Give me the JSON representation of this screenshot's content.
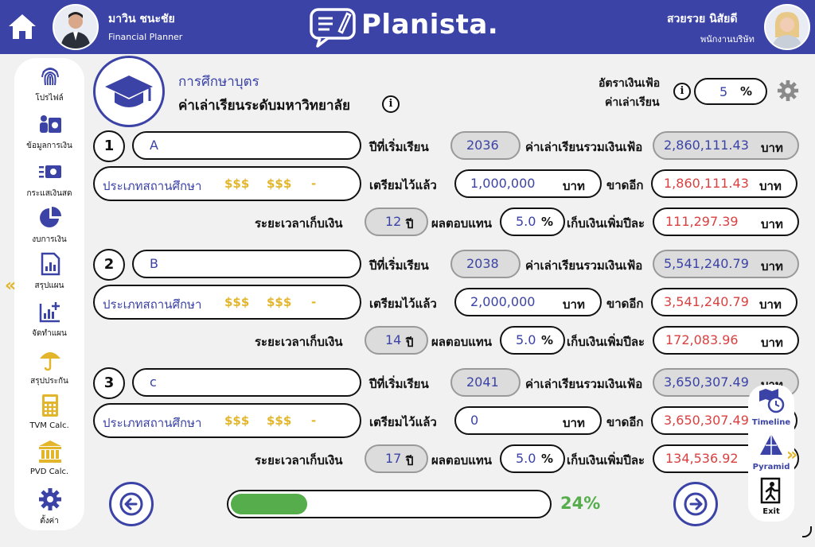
{
  "header": {
    "left_user": {
      "name": "มาวิน ชนะชัย",
      "role": "Financial Planner"
    },
    "brand": "Planista.",
    "right_user": {
      "name": "สวยรวย นิสัยดี",
      "role": "พนักงานบริษัท"
    }
  },
  "sidebar": {
    "items": [
      {
        "label": "โปรไฟล์",
        "icon": "fingerprint-icon"
      },
      {
        "label": "ข้อมูลการเงิน",
        "icon": "money-person-icon"
      },
      {
        "label": "กระแสเงินสด",
        "icon": "cashflow-icon"
      },
      {
        "label": "งบการเงิน",
        "icon": "pie-chart-icon"
      },
      {
        "label": "สรุปแผน",
        "icon": "report-icon"
      },
      {
        "label": "จัดทำแผน",
        "icon": "chart-plus-icon"
      },
      {
        "label": "สรุปประกัน",
        "icon": "umbrella-icon"
      },
      {
        "label": "TVM Calc.",
        "icon": "calculator-icon"
      },
      {
        "label": "PVD Calc.",
        "icon": "bank-icon"
      },
      {
        "label": "ตั้งค่า",
        "icon": "gear-icon"
      }
    ],
    "collapse": "«",
    "expand": "»"
  },
  "section": {
    "title": "การศึกษาบุตร",
    "subtitle": "ค่าเล่าเรียนระดับมหาวิทยาลัย",
    "inflation_label_1": "อัตราเงินเฟ้อ",
    "inflation_label_2": "ค่าเล่าเรียน",
    "inflation_value": "5",
    "inflation_unit": "%"
  },
  "labels": {
    "start_year": "ปีที่เริ่มเรียน",
    "total_cost": "ค่าเล่าเรียนรวมเงินเฟ้อ",
    "school_type": "ประเภทสถานศึกษา",
    "prepared": "เตรียมไว้แล้ว",
    "shortfall": "ขาดอีก",
    "saving_period": "ระยะเวลาเก็บเงิน",
    "return": "ผลตอบแทน",
    "annual_saving": "เก็บเงินเพิ่มปีละ",
    "baht": "บาท",
    "year": "ปี",
    "percent": "%",
    "dollar_a": "$$$",
    "dollar_b": "$$$",
    "dash": "-"
  },
  "children": [
    {
      "no": "1",
      "name": "A",
      "start_year": "2036",
      "total_cost": "2,860,111.43",
      "prepared": "1,000,000",
      "shortfall": "1,860,111.43",
      "period": "12",
      "return": "5.0",
      "annual_saving": "111,297.39"
    },
    {
      "no": "2",
      "name": "B",
      "start_year": "2038",
      "total_cost": "5,541,240.79",
      "prepared": "2,000,000",
      "shortfall": "3,541,240.79",
      "period": "14",
      "return": "5.0",
      "annual_saving": "172,083.96"
    },
    {
      "no": "3",
      "name": "c",
      "start_year": "2041",
      "total_cost": "3,650,307.49",
      "prepared": "0",
      "shortfall": "3,650,307.49",
      "period": "17",
      "return": "5.0",
      "annual_saving": "134,536.92"
    }
  ],
  "progress": {
    "text": "24%",
    "value": 0.24
  },
  "float_panel": {
    "items": [
      {
        "label": "Timeline",
        "icon": "timeline-icon"
      },
      {
        "label": "Pyramid",
        "icon": "pyramid-icon"
      },
      {
        "label": "Exit",
        "icon": "exit-icon"
      }
    ]
  },
  "colors": {
    "primary": "#3b43a6",
    "accent": "#e3b52a",
    "red": "#d94141",
    "green": "#55ad4b"
  }
}
